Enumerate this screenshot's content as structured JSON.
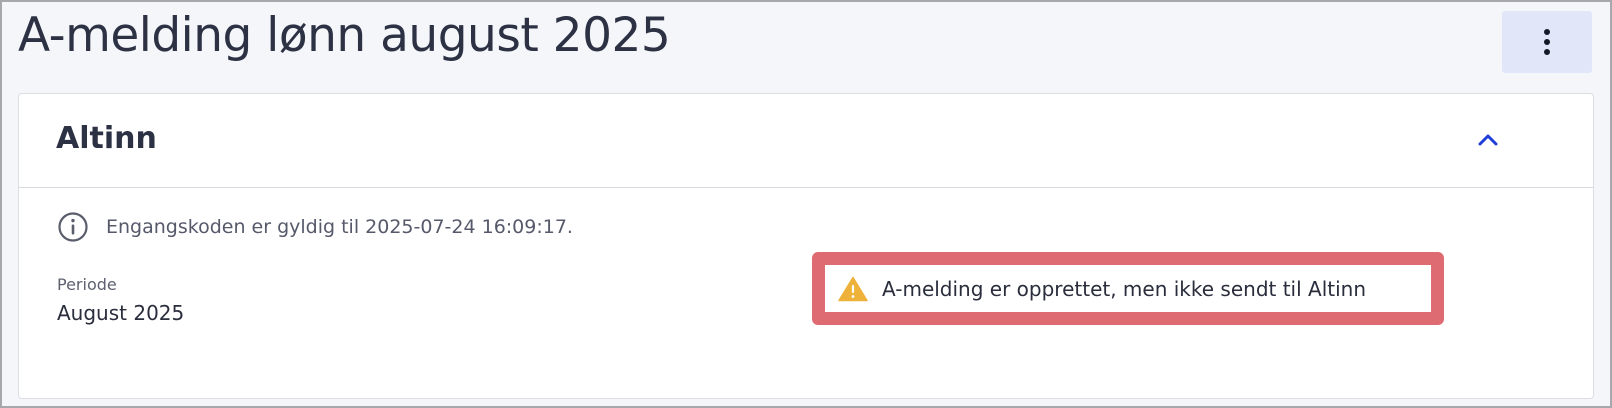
{
  "page": {
    "title": "A-melding lønn august 2025"
  },
  "menu": {
    "icon": "more-vertical-icon"
  },
  "altinn_section": {
    "title": "Altinn",
    "collapse_icon": "chevron-up-icon",
    "info_icon": "info-circle-icon",
    "info_text": "Engangskoden er gyldig til 2025-07-24 16:09:17.",
    "period_label": "Periode",
    "period_value": "August 2025",
    "warning": {
      "icon": "warning-triangle-icon",
      "text": "A-melding er opprettet, men ikke sendt til Altinn"
    }
  },
  "colors": {
    "accent": "#1f3fd6",
    "warning_icon": "#eeb23a",
    "warning_border": "#de6b72",
    "menu_button_bg": "#e1e6f8"
  }
}
